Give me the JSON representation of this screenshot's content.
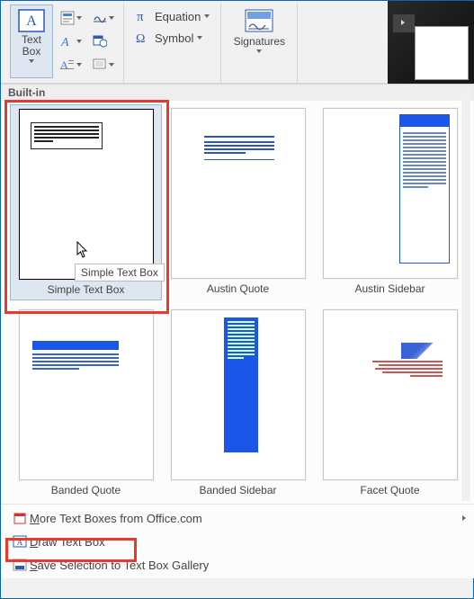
{
  "ribbon": {
    "textbox_btn_label": "Text\nBox",
    "equation_label": "Equation",
    "symbol_label": "Symbol",
    "signatures_label": "Signatures"
  },
  "gallery": {
    "header": "Built-in",
    "items": [
      {
        "label": "Simple Text Box"
      },
      {
        "label": "Austin Quote"
      },
      {
        "label": "Austin Sidebar"
      },
      {
        "label": "Banded Quote"
      },
      {
        "label": "Banded Sidebar"
      },
      {
        "label": "Facet Quote"
      }
    ],
    "tooltip": "Simple Text Box"
  },
  "footer": {
    "more": "More Text Boxes from Office.com",
    "draw": "Draw Text Box",
    "save": "Save Selection to Text Box Gallery"
  },
  "icons": {
    "textbox": "textbox-icon",
    "equation": "pi-icon",
    "symbol": "omega-icon",
    "signatures": "signature-icon"
  },
  "colors": {
    "accent": "#1a56e8",
    "highlight": "#e43b2c",
    "hover_bg": "#dde6f1"
  }
}
